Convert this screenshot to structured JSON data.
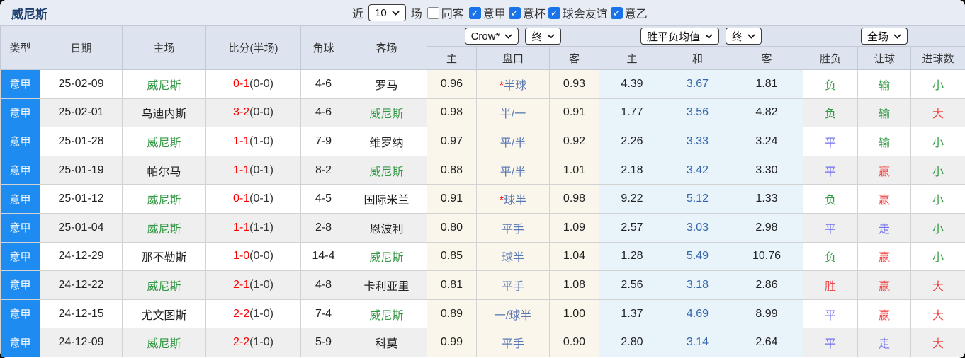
{
  "topbar": {
    "team": "威尼斯",
    "near_label": "近",
    "count": "10",
    "field_label": "场",
    "checkboxes": [
      {
        "label": "同客",
        "checked": false
      },
      {
        "label": "意甲",
        "checked": true
      },
      {
        "label": "意杯",
        "checked": true
      },
      {
        "label": "球会友谊",
        "checked": true
      },
      {
        "label": "意乙",
        "checked": true
      }
    ]
  },
  "colors": {
    "league_badge_blue": "#1e8bf0",
    "checkbox_blue": "#1a73e8",
    "score_red": "#ff0000",
    "venezia_green": "#339944",
    "win_red": "#f04848",
    "draw_blue": "#7070ee",
    "lose_green": "#339944",
    "handicap_text_blue": "#5878b3",
    "avg_draw_blue": "#3366aa",
    "header_bg": "#dde4ef",
    "topbar_bg": "#e8ecf5",
    "crow_col_bg": "#fbf6ec",
    "avg_col_bg": "#e9f3fa"
  },
  "table": {
    "headers": {
      "type": "类型",
      "date": "日期",
      "home": "主场",
      "score": "比分(半场)",
      "corner": "角球",
      "away": "客场",
      "h_home": "主",
      "h_handicap": "盘口",
      "h_away": "客",
      "a_home": "主",
      "a_draw": "和",
      "a_away": "客",
      "r_wdl": "胜负",
      "r_let": "让球",
      "r_goals": "进球数"
    },
    "selects": {
      "company": "Crow*",
      "company_time": "终",
      "avg": "胜平负均值",
      "avg_time": "终",
      "scope": "全场"
    },
    "rows": [
      {
        "type": "意甲",
        "date": "25-02-09",
        "home": "威尼斯",
        "score": "0-1",
        "half": "(0-0)",
        "corner": "4-6",
        "away": "罗马",
        "crow_home": "0.96",
        "star": "*",
        "handicap": "半球",
        "crow_away": "0.93",
        "avg_home": "4.39",
        "avg_draw": "3.67",
        "avg_away": "1.81",
        "wdl": "负",
        "wdl_color": "green",
        "let": "输",
        "let_color": "green",
        "goals": "小",
        "goals_color": "green"
      },
      {
        "type": "意甲",
        "date": "25-02-01",
        "home": "乌迪内斯",
        "score": "3-2",
        "half": "(0-0)",
        "corner": "4-6",
        "away": "威尼斯",
        "crow_home": "0.98",
        "star": "",
        "handicap": "半/一",
        "crow_away": "0.91",
        "avg_home": "1.77",
        "avg_draw": "3.56",
        "avg_away": "4.82",
        "wdl": "负",
        "wdl_color": "green",
        "let": "输",
        "let_color": "green",
        "goals": "大",
        "goals_color": "red"
      },
      {
        "type": "意甲",
        "date": "25-01-28",
        "home": "威尼斯",
        "score": "1-1",
        "half": "(1-0)",
        "corner": "7-9",
        "away": "维罗纳",
        "crow_home": "0.97",
        "star": "",
        "handicap": "平/半",
        "crow_away": "0.92",
        "avg_home": "2.26",
        "avg_draw": "3.33",
        "avg_away": "3.24",
        "wdl": "平",
        "wdl_color": "blue",
        "let": "输",
        "let_color": "green",
        "goals": "小",
        "goals_color": "green"
      },
      {
        "type": "意甲",
        "date": "25-01-19",
        "home": "帕尔马",
        "score": "1-1",
        "half": "(0-1)",
        "corner": "8-2",
        "away": "威尼斯",
        "crow_home": "0.88",
        "star": "",
        "handicap": "平/半",
        "crow_away": "1.01",
        "avg_home": "2.18",
        "avg_draw": "3.42",
        "avg_away": "3.30",
        "wdl": "平",
        "wdl_color": "blue",
        "let": "赢",
        "let_color": "red",
        "goals": "小",
        "goals_color": "green"
      },
      {
        "type": "意甲",
        "date": "25-01-12",
        "home": "威尼斯",
        "score": "0-1",
        "half": "(0-1)",
        "corner": "4-5",
        "away": "国际米兰",
        "crow_home": "0.91",
        "star": "*",
        "handicap": "球半",
        "crow_away": "0.98",
        "avg_home": "9.22",
        "avg_draw": "5.12",
        "avg_away": "1.33",
        "wdl": "负",
        "wdl_color": "green",
        "let": "赢",
        "let_color": "red",
        "goals": "小",
        "goals_color": "green"
      },
      {
        "type": "意甲",
        "date": "25-01-04",
        "home": "威尼斯",
        "score": "1-1",
        "half": "(1-1)",
        "corner": "2-8",
        "away": "恩波利",
        "crow_home": "0.80",
        "star": "",
        "handicap": "平手",
        "crow_away": "1.09",
        "avg_home": "2.57",
        "avg_draw": "3.03",
        "avg_away": "2.98",
        "wdl": "平",
        "wdl_color": "blue",
        "let": "走",
        "let_color": "blue",
        "goals": "小",
        "goals_color": "green"
      },
      {
        "type": "意甲",
        "date": "24-12-29",
        "home": "那不勒斯",
        "score": "1-0",
        "half": "(0-0)",
        "corner": "14-4",
        "away": "威尼斯",
        "crow_home": "0.85",
        "star": "",
        "handicap": "球半",
        "crow_away": "1.04",
        "avg_home": "1.28",
        "avg_draw": "5.49",
        "avg_away": "10.76",
        "wdl": "负",
        "wdl_color": "green",
        "let": "赢",
        "let_color": "red",
        "goals": "小",
        "goals_color": "green"
      },
      {
        "type": "意甲",
        "date": "24-12-22",
        "home": "威尼斯",
        "score": "2-1",
        "half": "(1-0)",
        "corner": "4-8",
        "away": "卡利亚里",
        "crow_home": "0.81",
        "star": "",
        "handicap": "平手",
        "crow_away": "1.08",
        "avg_home": "2.56",
        "avg_draw": "3.18",
        "avg_away": "2.86",
        "wdl": "胜",
        "wdl_color": "red",
        "let": "赢",
        "let_color": "red",
        "goals": "大",
        "goals_color": "red"
      },
      {
        "type": "意甲",
        "date": "24-12-15",
        "home": "尤文图斯",
        "score": "2-2",
        "half": "(1-0)",
        "corner": "7-4",
        "away": "威尼斯",
        "crow_home": "0.89",
        "star": "",
        "handicap": "一/球半",
        "crow_away": "1.00",
        "avg_home": "1.37",
        "avg_draw": "4.69",
        "avg_away": "8.99",
        "wdl": "平",
        "wdl_color": "blue",
        "let": "赢",
        "let_color": "red",
        "goals": "大",
        "goals_color": "red"
      },
      {
        "type": "意甲",
        "date": "24-12-09",
        "home": "威尼斯",
        "score": "2-2",
        "half": "(1-0)",
        "corner": "5-9",
        "away": "科莫",
        "crow_home": "0.99",
        "star": "",
        "handicap": "平手",
        "crow_away": "0.90",
        "avg_home": "2.80",
        "avg_draw": "3.14",
        "avg_away": "2.64",
        "wdl": "平",
        "wdl_color": "blue",
        "let": "走",
        "let_color": "blue",
        "goals": "大",
        "goals_color": "red"
      }
    ]
  }
}
